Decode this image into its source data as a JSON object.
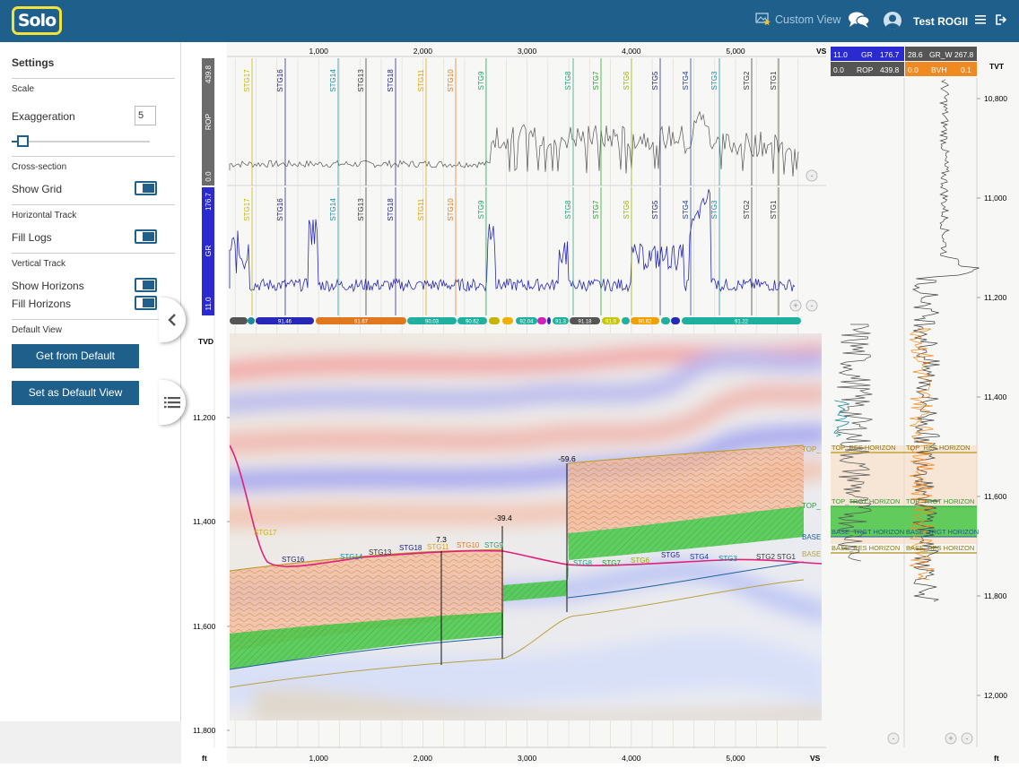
{
  "header": {
    "logo_text": "Solo",
    "custom_view_label": "Custom View",
    "user_name": "Test ROGII",
    "colors": {
      "bar": "#1f5f8b",
      "logo_border": "#f2e23a"
    },
    "icons": [
      "custom-view-icon",
      "chat-icon",
      "user-avatar-icon",
      "menu-icon",
      "logout-icon"
    ]
  },
  "sidebar": {
    "title": "Settings",
    "scale_section": "Scale",
    "exaggeration_label": "Exaggeration",
    "exaggeration_value": "5",
    "cross_section": "Cross-section",
    "show_grid_label": "Show Grid",
    "show_grid": true,
    "horizontal_track": "Horizontal Track",
    "fill_logs_label": "Fill Logs",
    "fill_logs": true,
    "vertical_track": "Vertical Track",
    "show_horizons_label": "Show Horizons",
    "show_horizons": true,
    "fill_horizons_label": "Fill Horizons",
    "fill_horizons": true,
    "default_view": "Default View",
    "get_default_btn": "Get from Default",
    "set_default_btn": "Set as Default View"
  },
  "vs_axis": {
    "ticks": [
      "1,000",
      "2,000",
      "3,000",
      "4,000",
      "5,000"
    ],
    "label": "VS",
    "unit": "ft"
  },
  "rop_track": {
    "name": "ROP",
    "top": "439.8",
    "bottom": "0.0"
  },
  "gr_track": {
    "name": "GR",
    "top": "176.7",
    "bottom": "11.0"
  },
  "stages": [
    "STG17",
    "STG16",
    "STG14",
    "STG13",
    "STG18",
    "STG11",
    "STG10",
    "STG9",
    "STG8",
    "STG7",
    "STG6",
    "STG5",
    "STG4",
    "STG3",
    "STG2",
    "STG1"
  ],
  "stage_colors": [
    "#c8b400",
    "#1a1a7a",
    "#1a8aa0",
    "#333333",
    "#1a1a7a",
    "#e0a000",
    "#e07820",
    "#20a060",
    "#20a080",
    "#20a020",
    "#a0b000",
    "#1a1a7a",
    "#1a3aa0",
    "#1a8aa0",
    "#333333",
    "#333333"
  ],
  "segment_bar": [
    "91.46",
    "91.67",
    "90.03",
    "90.62",
    "92.04",
    "91.3",
    "91.18",
    "91.9",
    "90.62",
    "91.22"
  ],
  "cross_section": {
    "tvd_label": "TVD",
    "tvd_ticks": [
      "11,200",
      "11,400",
      "11,600",
      "11,800"
    ],
    "annotations": [
      "7.3",
      "-39.4",
      "-59.6"
    ],
    "horizon_labels": [
      "TOP_",
      "TOP_",
      "BASE",
      "BASE"
    ]
  },
  "log_track": {
    "header": [
      {
        "min": "11.0",
        "name": "GR",
        "max": "176.7"
      },
      {
        "min": "28.6",
        "name": "GR_W",
        "max": "267.8"
      },
      {
        "min": "0.0",
        "name": "ROP",
        "max": "439.8"
      },
      {
        "min": "0.0",
        "name": "BVH",
        "max": "0.1"
      }
    ],
    "tvt_label": "TVT",
    "tvt_ticks": [
      "10,800",
      "11,000",
      "11,200",
      "11,400",
      "11,600",
      "11,800",
      "12,000"
    ],
    "horizons": [
      "TOP_RES HORIZON",
      "TOP_RES HORIZON",
      "TOP_TRGT HORIZON",
      "TOP_TRGT HORIZON",
      "BASE_TRGT HORIZON",
      "BASE_TRGT HORIZON",
      "BASE_RES HORIZON",
      "BASE_RES HORIZON"
    ],
    "unit": "ft"
  }
}
